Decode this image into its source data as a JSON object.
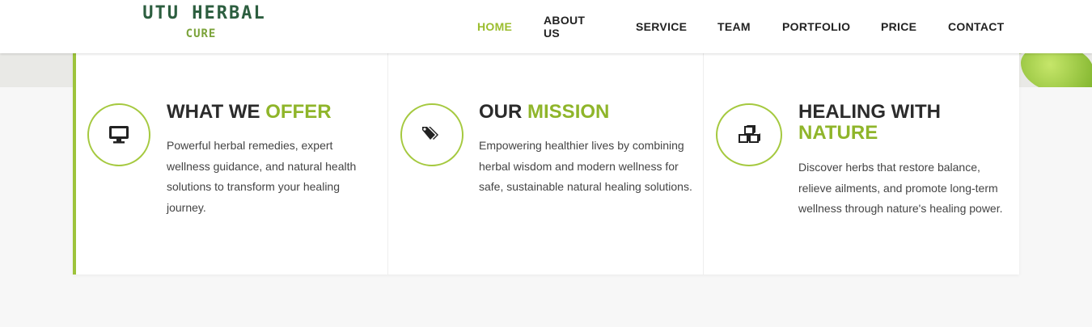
{
  "brand": {
    "name": "UTU HERBAL",
    "tagline": "CURE"
  },
  "nav": {
    "items": [
      {
        "label": "HOME",
        "active": true
      },
      {
        "label": "ABOUT US",
        "active": false
      },
      {
        "label": "SERVICE",
        "active": false
      },
      {
        "label": "TEAM",
        "active": false
      },
      {
        "label": "PORTFOLIO",
        "active": false
      },
      {
        "label": "PRICE",
        "active": false
      },
      {
        "label": "CONTACT",
        "active": false
      }
    ]
  },
  "features": [
    {
      "icon": "desktop-icon",
      "title_plain": "WHAT WE",
      "title_highlight": "OFFER",
      "text": "Powerful herbal remedies, expert wellness guidance, and natural health solutions to transform your healing journey."
    },
    {
      "icon": "tags-icon",
      "title_plain": "OUR",
      "title_highlight": "MISSION",
      "text": "Empowering healthier lives by combining herbal wisdom and modern wellness for safe, sustainable natural healing solutions."
    },
    {
      "icon": "cubes-icon",
      "title_plain": "HEALING WITH",
      "title_highlight": "NATURE",
      "text": "Discover herbs that restore balance, relieve ailments, and promote long-term wellness through nature's healing power."
    }
  ],
  "colors": {
    "accent": "#9bbd2e",
    "brand_dark": "#2c5e3f",
    "text": "#2b2b2b"
  }
}
